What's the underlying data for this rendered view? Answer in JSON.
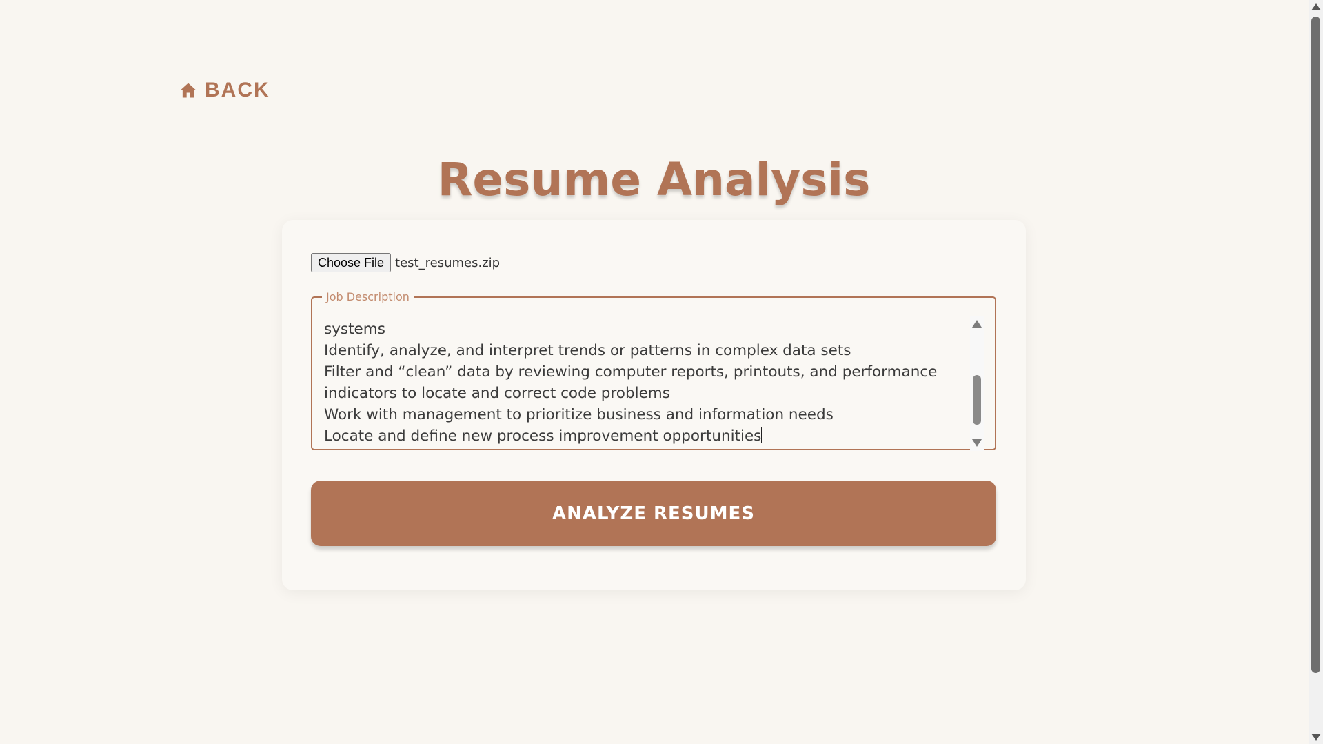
{
  "nav": {
    "back_label": "BACK",
    "back_icon": "home-icon"
  },
  "page": {
    "title": "Resume Analysis"
  },
  "upload": {
    "button_label": "Choose File",
    "file_name": "test_resumes.zip"
  },
  "job_description": {
    "legend": "Job Description",
    "visible_lines": [
      "systems",
      "Identify, analyze, and interpret trends or patterns in complex data sets",
      "Filter and “clean” data by reviewing computer reports, printouts, and performance",
      "indicators to locate and correct code problems",
      "Work with management to prioritize business and information needs",
      "Locate and define new process improvement opportunities"
    ]
  },
  "actions": {
    "analyze_label": "ANALYZE RESUMES"
  },
  "colors": {
    "accent": "#b17456",
    "background": "#f9f6f1",
    "card": "#faf8f4",
    "legend": "#c28a6d",
    "text": "#3b3b3b"
  }
}
